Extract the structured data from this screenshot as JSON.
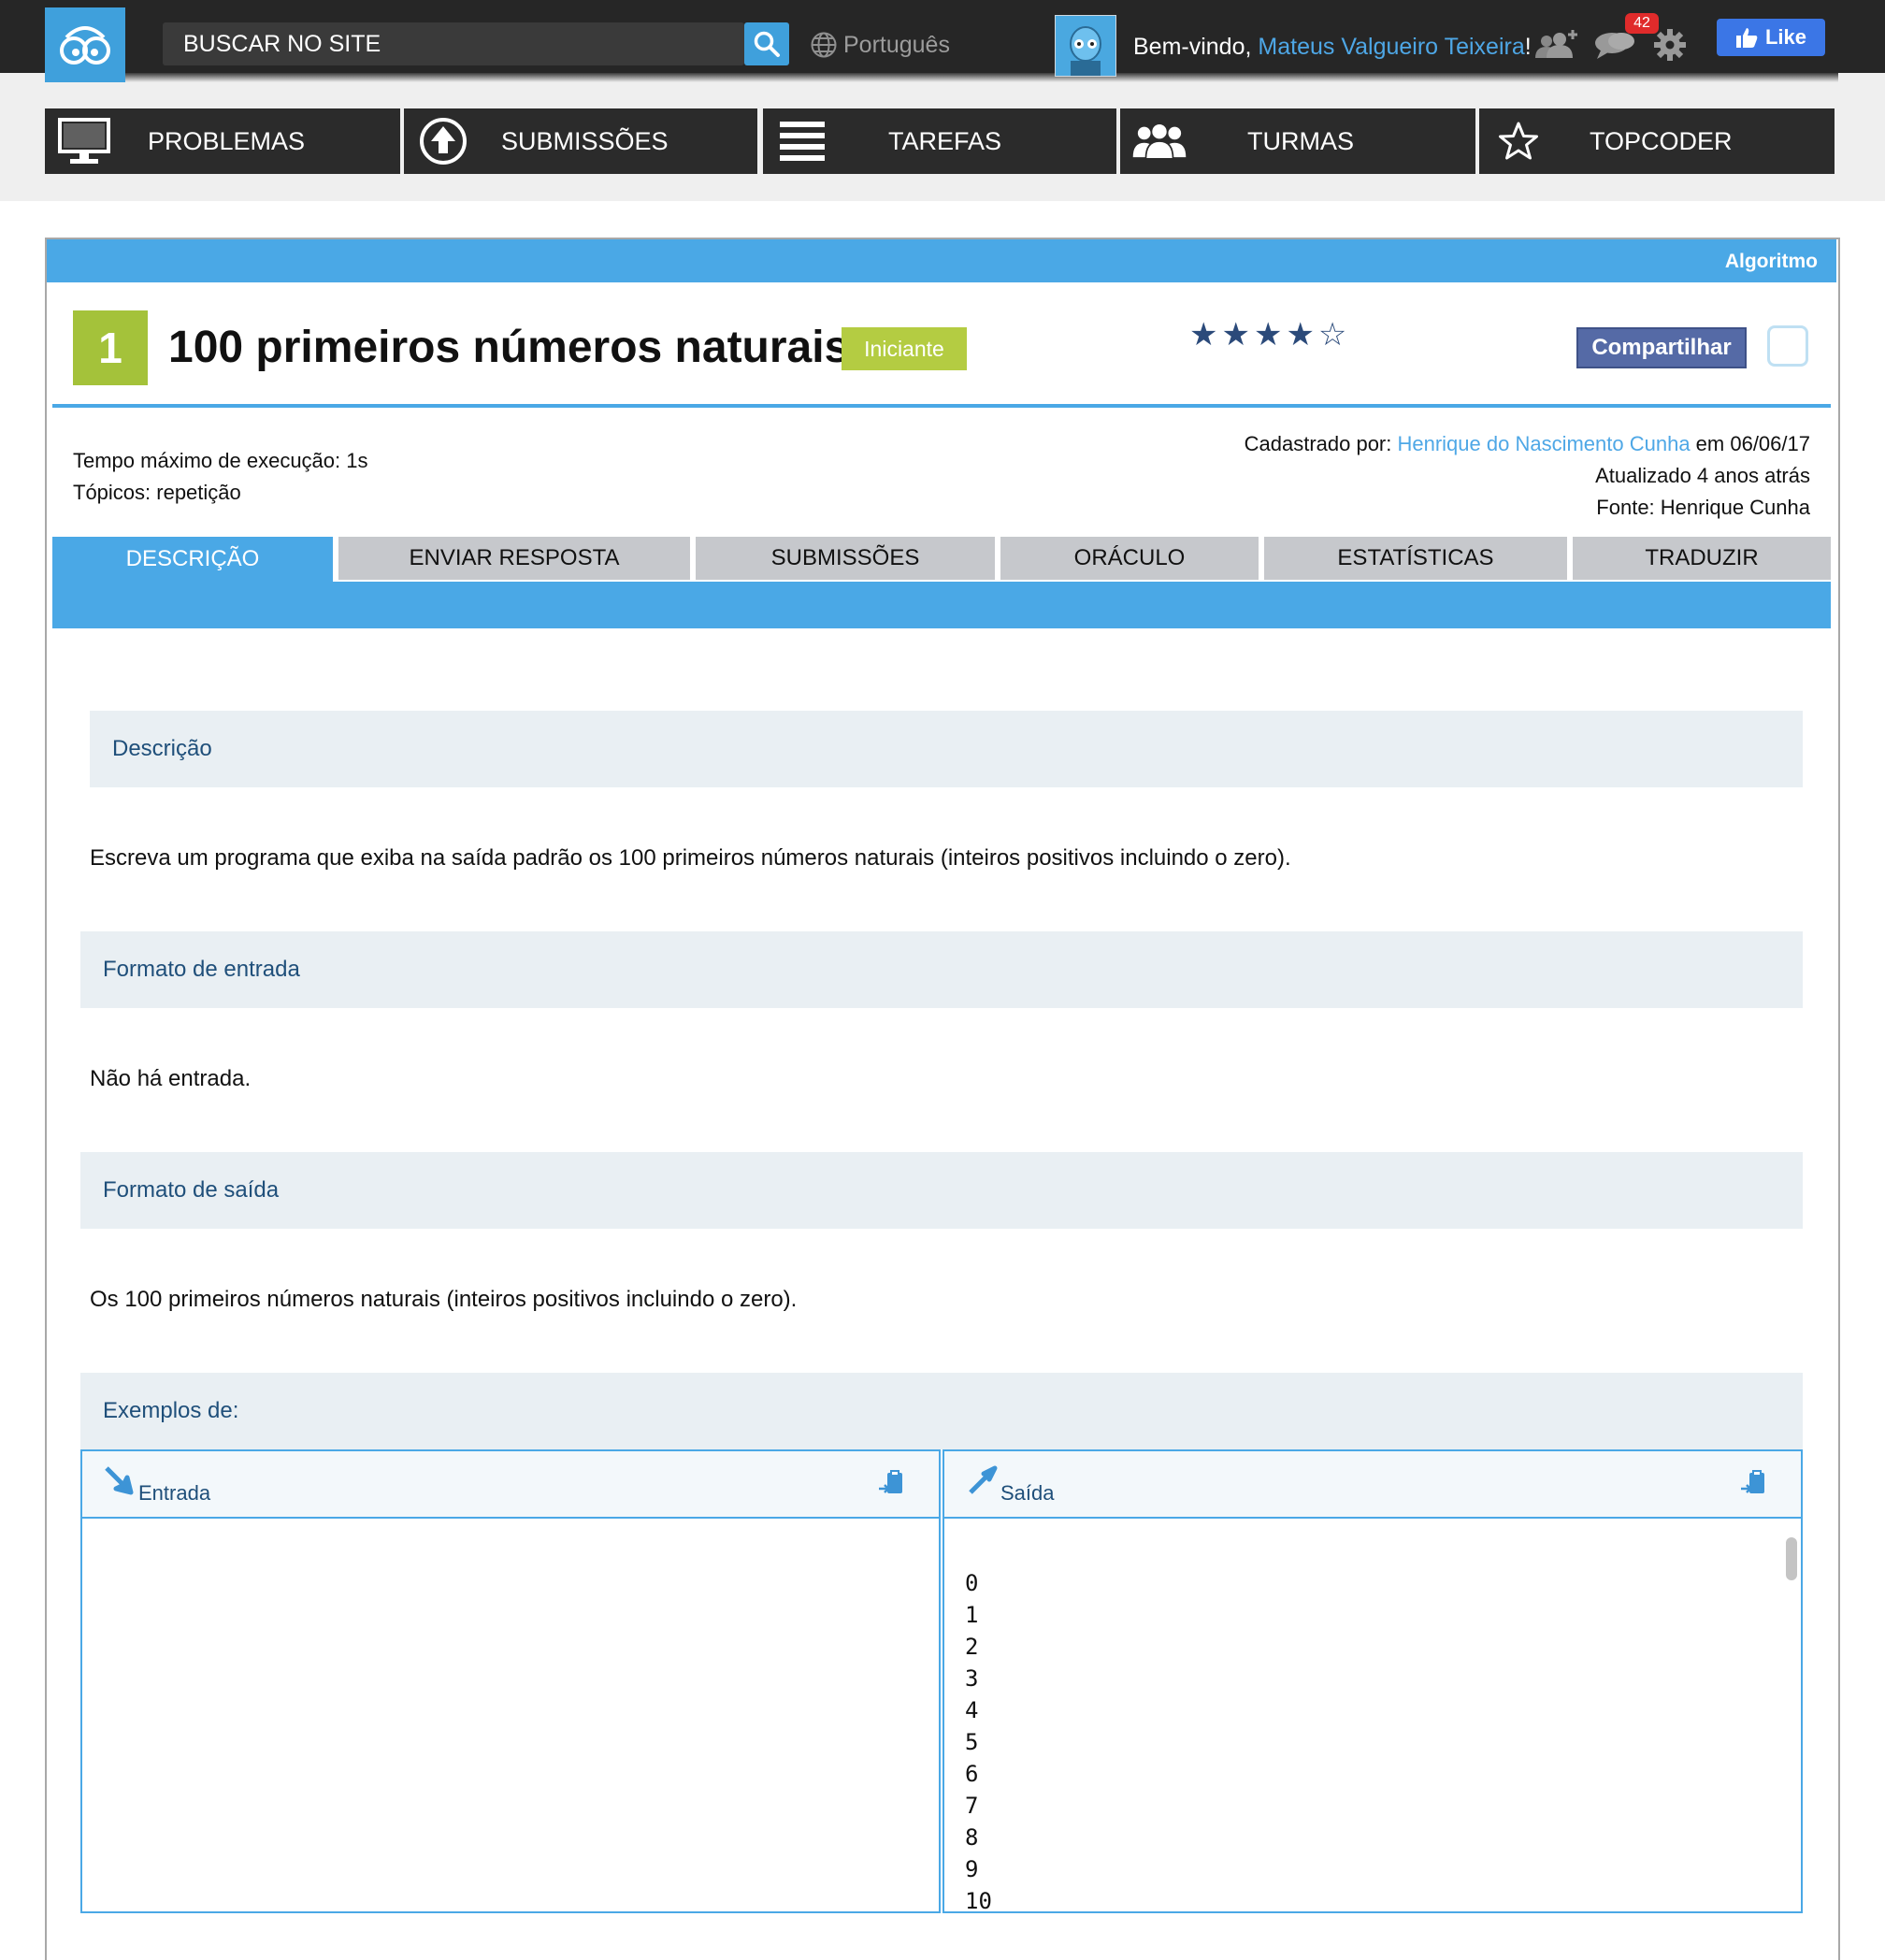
{
  "topbar": {
    "search_placeholder": "BUSCAR NO SITE",
    "language": "Português",
    "welcome_prefix": "Bem-vindo, ",
    "user_name": "Mateus Valgueiro Teixeira",
    "welcome_suffix": "!",
    "notifications_count": "42",
    "like_label": "Like",
    "colors": {
      "bar": "#262626",
      "accent": "#3fa0dc",
      "badge": "#e02b2b",
      "facebook": "#3b76e6"
    }
  },
  "nav": {
    "items": [
      {
        "label": "PROBLEMAS",
        "icon": "monitor-icon"
      },
      {
        "label": "SUBMISSÕES",
        "icon": "upload-circle-icon"
      },
      {
        "label": "TAREFAS",
        "icon": "list-lines-icon"
      },
      {
        "label": "TURMAS",
        "icon": "group-people-icon"
      },
      {
        "label": "TOPCODER",
        "icon": "star-outline-icon"
      }
    ]
  },
  "problem": {
    "category": "Algoritmo",
    "number": "1",
    "title": "100 primeiros números naturais",
    "level": "Iniciante",
    "rating_stars": "★★★★☆",
    "rating_value": 4,
    "rating_max": 5,
    "share_label": "Compartilhar",
    "time_limit": "Tempo máximo de execução: 1s",
    "topics": "Tópicos: repetição",
    "registered_prefix": "Cadastrado por: ",
    "registered_by": "Henrique do Nascimento Cunha",
    "registered_suffix": " em 06/06/17",
    "updated": "Atualizado 4 anos atrás",
    "source": "Fonte: Henrique Cunha",
    "colors": {
      "header": "#4aa8e6",
      "number_box": "#a4c23a",
      "level": "#b4cc42",
      "share": "#556aa6"
    }
  },
  "tabs": [
    {
      "label": "DESCRIÇÃO",
      "active": true
    },
    {
      "label": "ENVIAR RESPOSTA",
      "active": false
    },
    {
      "label": "SUBMISSÕES",
      "active": false
    },
    {
      "label": "ORÁCULO",
      "active": false
    },
    {
      "label": "ESTATÍSTICAS",
      "active": false
    },
    {
      "label": "TRADUZIR",
      "active": false
    }
  ],
  "sections": {
    "description_title": "Descrição",
    "description_text": "Escreva um programa que exiba na saída padrão os 100 primeiros números naturais (inteiros positivos incluindo o zero).",
    "input_title": "Formato de entrada",
    "input_text": "Não há entrada.",
    "output_title": "Formato de saída",
    "output_text": "Os 100 primeiros números naturais (inteiros positivos incluindo o zero).",
    "examples_title": "Exemplos de:"
  },
  "examples": {
    "input_label": "Entrada",
    "output_label": "Saída",
    "input_value": "",
    "output_lines": [
      "0",
      "1",
      "2",
      "3",
      "4",
      "5",
      "6",
      "7",
      "8",
      "9",
      "10"
    ]
  }
}
